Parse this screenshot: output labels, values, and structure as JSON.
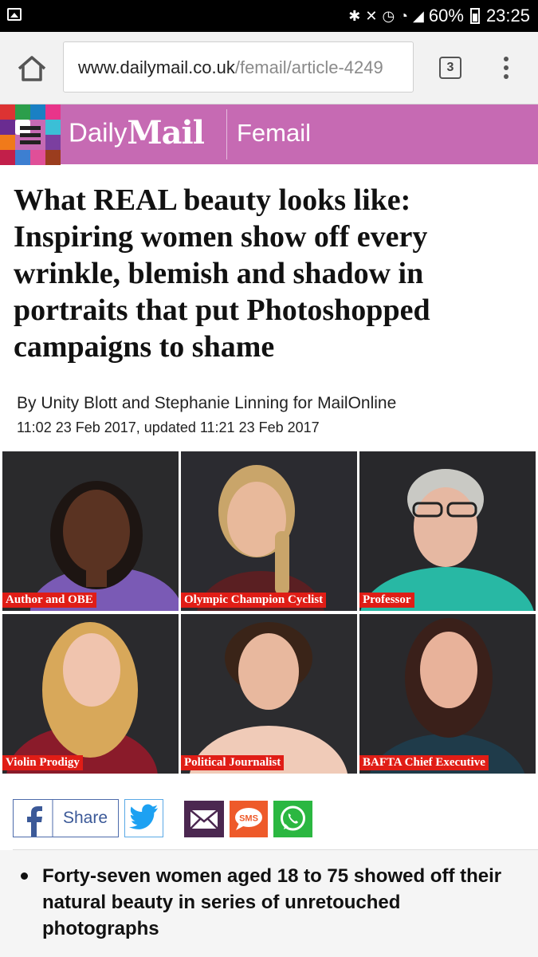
{
  "status_bar": {
    "battery": "60%",
    "time": "23:25"
  },
  "browser": {
    "url_domain": "www.dailymail.co.uk",
    "url_path": "/femail/article-4249",
    "tab_count": "3"
  },
  "site": {
    "logo_daily": "Daily",
    "logo_mail": "Mail",
    "section": "Femail",
    "accent": "#c66ab3"
  },
  "article": {
    "headline": "What REAL beauty looks like: Inspiring women show off every wrinkle, blemish and shadow in portraits that put Photoshopped campaigns to shame",
    "byline": "By Unity Blott and Stephanie Linning for MailOnline",
    "timestamp": "11:02 23 Feb 2017, updated 11:21 23 Feb 2017",
    "photos": [
      {
        "caption": "Author and OBE"
      },
      {
        "caption": "Olympic Champion Cyclist"
      },
      {
        "caption": "Professor"
      },
      {
        "caption": "Violin Prodigy"
      },
      {
        "caption": "Political Journalist"
      },
      {
        "caption": "BAFTA Chief Executive"
      }
    ],
    "summary": "Forty-seven women aged 18 to 75 showed off their natural beauty in series of unretouched photographs"
  },
  "share": {
    "facebook_label": "Share",
    "sms_label": "SMS"
  }
}
